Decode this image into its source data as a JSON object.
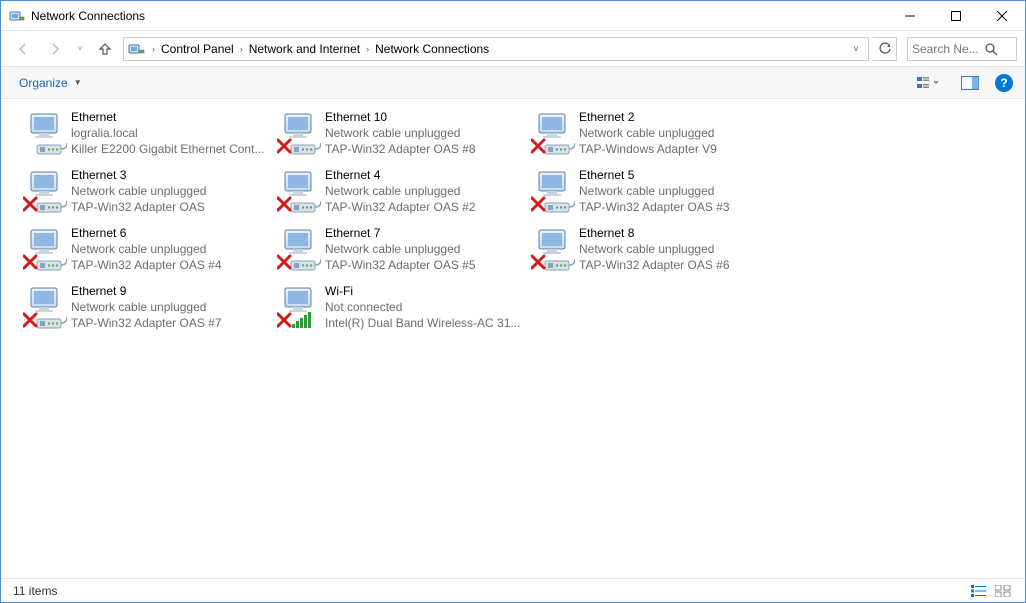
{
  "window": {
    "title": "Network Connections"
  },
  "breadcrumbs": [
    {
      "label": "Control Panel"
    },
    {
      "label": "Network and Internet"
    },
    {
      "label": "Network Connections"
    }
  ],
  "search": {
    "placeholder": "Search Ne..."
  },
  "toolbar": {
    "organize_label": "Organize"
  },
  "connections": [
    {
      "name": "Ethernet",
      "status": "logralia.local",
      "adapter": "Killer E2200 Gigabit Ethernet Cont...",
      "state": "connected",
      "type": "ethernet"
    },
    {
      "name": "Ethernet 10",
      "status": "Network cable unplugged",
      "adapter": "TAP-Win32 Adapter OAS #8",
      "state": "unplugged",
      "type": "ethernet"
    },
    {
      "name": "Ethernet 2",
      "status": "Network cable unplugged",
      "adapter": "TAP-Windows Adapter V9",
      "state": "unplugged",
      "type": "ethernet"
    },
    {
      "name": "Ethernet 3",
      "status": "Network cable unplugged",
      "adapter": "TAP-Win32 Adapter OAS",
      "state": "unplugged",
      "type": "ethernet"
    },
    {
      "name": "Ethernet 4",
      "status": "Network cable unplugged",
      "adapter": "TAP-Win32 Adapter OAS #2",
      "state": "unplugged",
      "type": "ethernet"
    },
    {
      "name": "Ethernet 5",
      "status": "Network cable unplugged",
      "adapter": "TAP-Win32 Adapter OAS #3",
      "state": "unplugged",
      "type": "ethernet"
    },
    {
      "name": "Ethernet 6",
      "status": "Network cable unplugged",
      "adapter": "TAP-Win32 Adapter OAS #4",
      "state": "unplugged",
      "type": "ethernet"
    },
    {
      "name": "Ethernet 7",
      "status": "Network cable unplugged",
      "adapter": "TAP-Win32 Adapter OAS #5",
      "state": "unplugged",
      "type": "ethernet"
    },
    {
      "name": "Ethernet 8",
      "status": "Network cable unplugged",
      "adapter": "TAP-Win32 Adapter OAS #6",
      "state": "unplugged",
      "type": "ethernet"
    },
    {
      "name": "Ethernet 9",
      "status": "Network cable unplugged",
      "adapter": "TAP-Win32 Adapter OAS #7",
      "state": "unplugged",
      "type": "ethernet"
    },
    {
      "name": "Wi-Fi",
      "status": "Not connected",
      "adapter": "Intel(R) Dual Band Wireless-AC 31...",
      "state": "unplugged",
      "type": "wifi"
    }
  ],
  "statusbar": {
    "count_text": "11 items"
  }
}
